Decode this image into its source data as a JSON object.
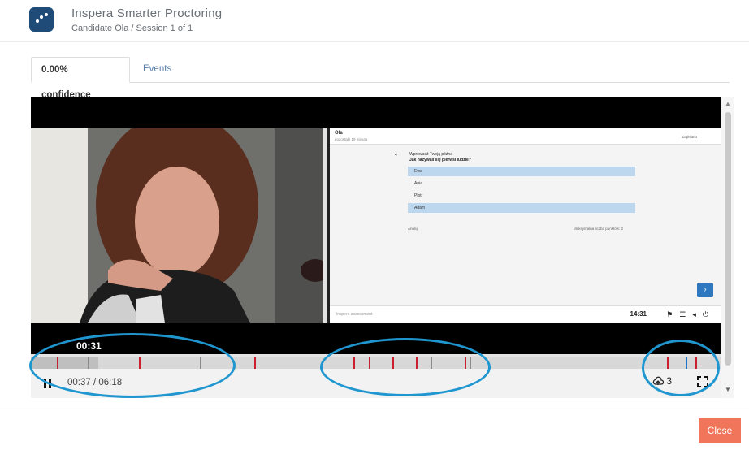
{
  "header": {
    "app_title": "Inspera Smarter Proctoring",
    "subtitle": "Candidate Ola / Session 1 of 1"
  },
  "tabs": [
    {
      "label": "0.00% confidence",
      "active": true
    },
    {
      "label": "Events",
      "active": false
    }
  ],
  "player": {
    "overlay_time": "00:31",
    "current_time": "00:37 / 06:18",
    "progress_fraction": 0.098,
    "cloud_count": "3",
    "pause_icon": "pause-icon",
    "cloud_icon": "cloud-upload-icon",
    "fullscreen_icon": "fullscreen-icon",
    "accent_color": "#1f96cf",
    "marker_colors": {
      "red": "#cc1f2d",
      "gray": "#8a8a8a",
      "blue": "#1a73c7"
    }
  },
  "screen": {
    "candidate_name": "Ola",
    "candidate_sub": "pozostało 19 minuta",
    "status": "Zapisano",
    "question_number": "4",
    "question_intro": "Wprowadź Twoją późną",
    "question_text": "Jak nazywali się pierwsi ludzie?",
    "options": [
      {
        "label": "Ewa",
        "selected": true
      },
      {
        "label": "Ania",
        "selected": false
      },
      {
        "label": "Piotr",
        "selected": false
      },
      {
        "label": "Adam",
        "selected": true
      }
    ],
    "footer_left": "Anuluj",
    "footer_right": "Maksymalna liczba punktów: 2",
    "brand": "inspera assessment",
    "clock": "14:31"
  },
  "footer": {
    "close_label": "Close",
    "close_color": "#f0755a"
  }
}
